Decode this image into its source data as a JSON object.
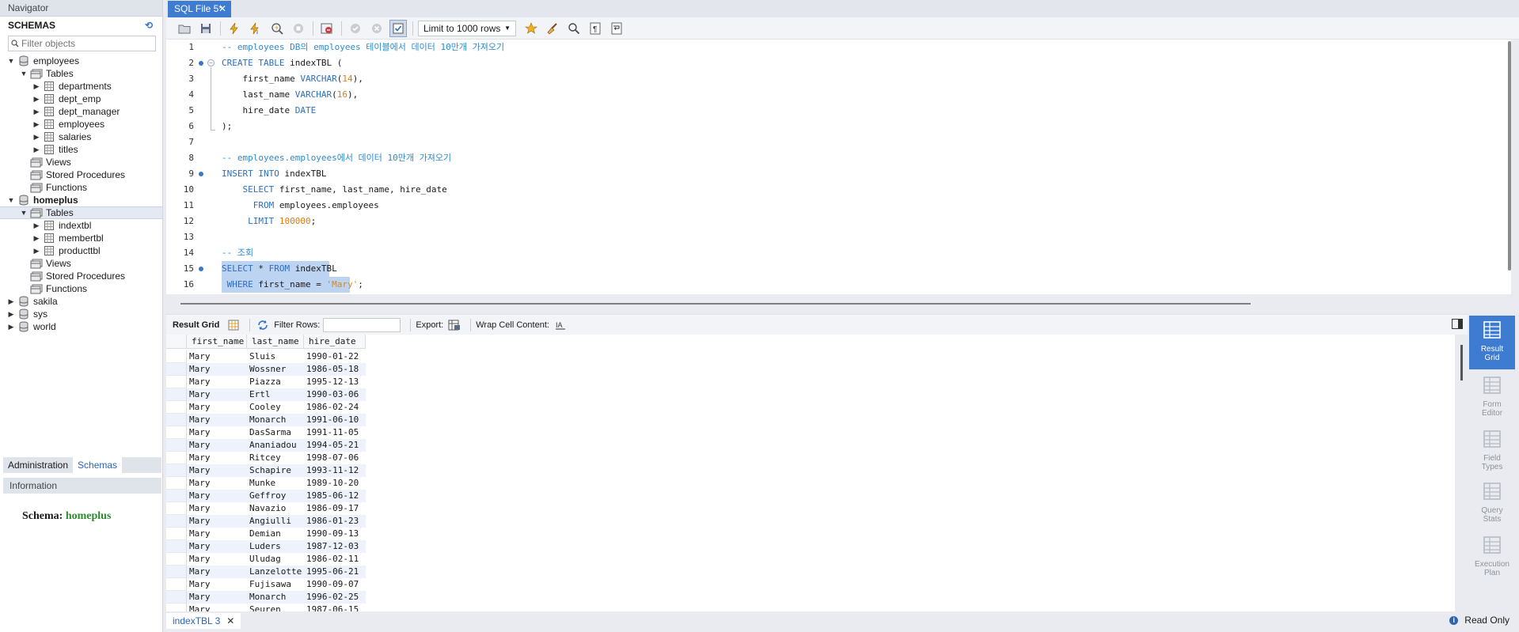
{
  "navigator": {
    "title": "Navigator",
    "schemas_title": "SCHEMAS",
    "filter_placeholder": "Filter objects",
    "tree": [
      {
        "label": "employees",
        "level": 0,
        "type": "db",
        "expanded": true,
        "bold": false
      },
      {
        "label": "Tables",
        "level": 1,
        "type": "folder",
        "expanded": true
      },
      {
        "label": "departments",
        "level": 2,
        "type": "table"
      },
      {
        "label": "dept_emp",
        "level": 2,
        "type": "table"
      },
      {
        "label": "dept_manager",
        "level": 2,
        "type": "table"
      },
      {
        "label": "employees",
        "level": 2,
        "type": "table"
      },
      {
        "label": "salaries",
        "level": 2,
        "type": "table"
      },
      {
        "label": "titles",
        "level": 2,
        "type": "table"
      },
      {
        "label": "Views",
        "level": 1,
        "type": "folder",
        "leaf": true
      },
      {
        "label": "Stored Procedures",
        "level": 1,
        "type": "folder",
        "leaf": true
      },
      {
        "label": "Functions",
        "level": 1,
        "type": "folder",
        "leaf": true
      },
      {
        "label": "homeplus",
        "level": 0,
        "type": "db",
        "expanded": true,
        "bold": true
      },
      {
        "label": "Tables",
        "level": 1,
        "type": "folder",
        "expanded": true,
        "selected": true
      },
      {
        "label": "indextbl",
        "level": 2,
        "type": "table"
      },
      {
        "label": "membertbl",
        "level": 2,
        "type": "table"
      },
      {
        "label": "producttbl",
        "level": 2,
        "type": "table"
      },
      {
        "label": "Views",
        "level": 1,
        "type": "folder",
        "leaf": true
      },
      {
        "label": "Stored Procedures",
        "level": 1,
        "type": "folder",
        "leaf": true
      },
      {
        "label": "Functions",
        "level": 1,
        "type": "folder",
        "leaf": true
      },
      {
        "label": "sakila",
        "level": 0,
        "type": "db"
      },
      {
        "label": "sys",
        "level": 0,
        "type": "db"
      },
      {
        "label": "world",
        "level": 0,
        "type": "db"
      }
    ],
    "tabs": [
      "Administration",
      "Schemas"
    ],
    "active_tab": "Schemas",
    "info_title": "Information",
    "info_label": "Schema:",
    "info_value": "homeplus"
  },
  "editor": {
    "tab_title": "SQL File 5*",
    "limit_select": "Limit to 1000 rows",
    "lines": [
      {
        "n": "1",
        "html": "<span class='c'>-- employees DB의 employees 테이블에서 데이터 10만개 가져오기</span>"
      },
      {
        "n": "2",
        "bp": true,
        "fold": true,
        "html": "<span class='k'>CREATE TABLE</span> indexTBL ("
      },
      {
        "n": "3",
        "html": "    first_name <span class='k'>VARCHAR</span>(<span class='n'>14</span>),"
      },
      {
        "n": "4",
        "html": "    last_name <span class='k'>VARCHAR</span>(<span class='n'>16</span>),"
      },
      {
        "n": "5",
        "html": "    hire_date <span class='k'>DATE</span>"
      },
      {
        "n": "6",
        "html": ");"
      },
      {
        "n": "7",
        "html": ""
      },
      {
        "n": "8",
        "html": "<span class='c'>-- employees.employees에서 데이터 10만개 가져오기</span>"
      },
      {
        "n": "9",
        "bp": true,
        "html": "<span class='k'>INSERT INTO</span> indexTBL"
      },
      {
        "n": "10",
        "html": "    <span class='k'>SELECT</span> first_name, last_name, hire_date"
      },
      {
        "n": "11",
        "html": "      <span class='k'>FROM</span> employees.employees"
      },
      {
        "n": "12",
        "html": "     <span class='k'>LIMIT</span> <span class='n'>100000</span>;"
      },
      {
        "n": "13",
        "html": ""
      },
      {
        "n": "14",
        "html": "<span class='c'>-- 조회</span>"
      },
      {
        "n": "15",
        "bp": true,
        "selected": true,
        "html": "<span class='k'>SELECT</span> * <span class='k'>FROM</span> indexTBL"
      },
      {
        "n": "16",
        "selected": true,
        "html": " <span class='k'>WHERE</span> first_name = <span class='s'>'Mary'</span>;"
      }
    ]
  },
  "results": {
    "tab_label": "Result Grid",
    "filter_label": "Filter Rows:",
    "export_label": "Export:",
    "wrap_label": "Wrap Cell Content:",
    "columns": [
      "first_name",
      "last_name",
      "hire_date"
    ],
    "rows": [
      [
        "Mary",
        "Sluis",
        "1990-01-22"
      ],
      [
        "Mary",
        "Wossner",
        "1986-05-18"
      ],
      [
        "Mary",
        "Piazza",
        "1995-12-13"
      ],
      [
        "Mary",
        "Ertl",
        "1990-03-06"
      ],
      [
        "Mary",
        "Cooley",
        "1986-02-24"
      ],
      [
        "Mary",
        "Monarch",
        "1991-06-10"
      ],
      [
        "Mary",
        "DasSarma",
        "1991-11-05"
      ],
      [
        "Mary",
        "Ananiadou",
        "1994-05-21"
      ],
      [
        "Mary",
        "Ritcey",
        "1998-07-06"
      ],
      [
        "Mary",
        "Schapire",
        "1993-11-12"
      ],
      [
        "Mary",
        "Munke",
        "1989-10-20"
      ],
      [
        "Mary",
        "Geffroy",
        "1985-06-12"
      ],
      [
        "Mary",
        "Navazio",
        "1986-09-17"
      ],
      [
        "Mary",
        "Angiulli",
        "1986-01-23"
      ],
      [
        "Mary",
        "Demian",
        "1990-09-13"
      ],
      [
        "Mary",
        "Luders",
        "1987-12-03"
      ],
      [
        "Mary",
        "Uludag",
        "1986-02-11"
      ],
      [
        "Mary",
        "Lanzelotte",
        "1995-06-21"
      ],
      [
        "Mary",
        "Fujisawa",
        "1990-09-07"
      ],
      [
        "Mary",
        "Monarch",
        "1996-02-25"
      ],
      [
        "Mary",
        "Seuren",
        "1987-06-15"
      ]
    ]
  },
  "side_panel": [
    {
      "label1": "Result",
      "label2": "Grid",
      "active": true
    },
    {
      "label1": "Form",
      "label2": "Editor"
    },
    {
      "label1": "Field",
      "label2": "Types"
    },
    {
      "label1": "Query",
      "label2": "Stats"
    },
    {
      "label1": "Execution",
      "label2": "Plan"
    }
  ],
  "bottom": {
    "result_tab": "indexTBL 3",
    "status": "Read Only"
  },
  "colors": {
    "accent": "#3d7cd0",
    "keyword": "#2a6fc5",
    "comment": "#2a8bd1",
    "number": "#e07b14",
    "selection": "#bcd3f2"
  }
}
